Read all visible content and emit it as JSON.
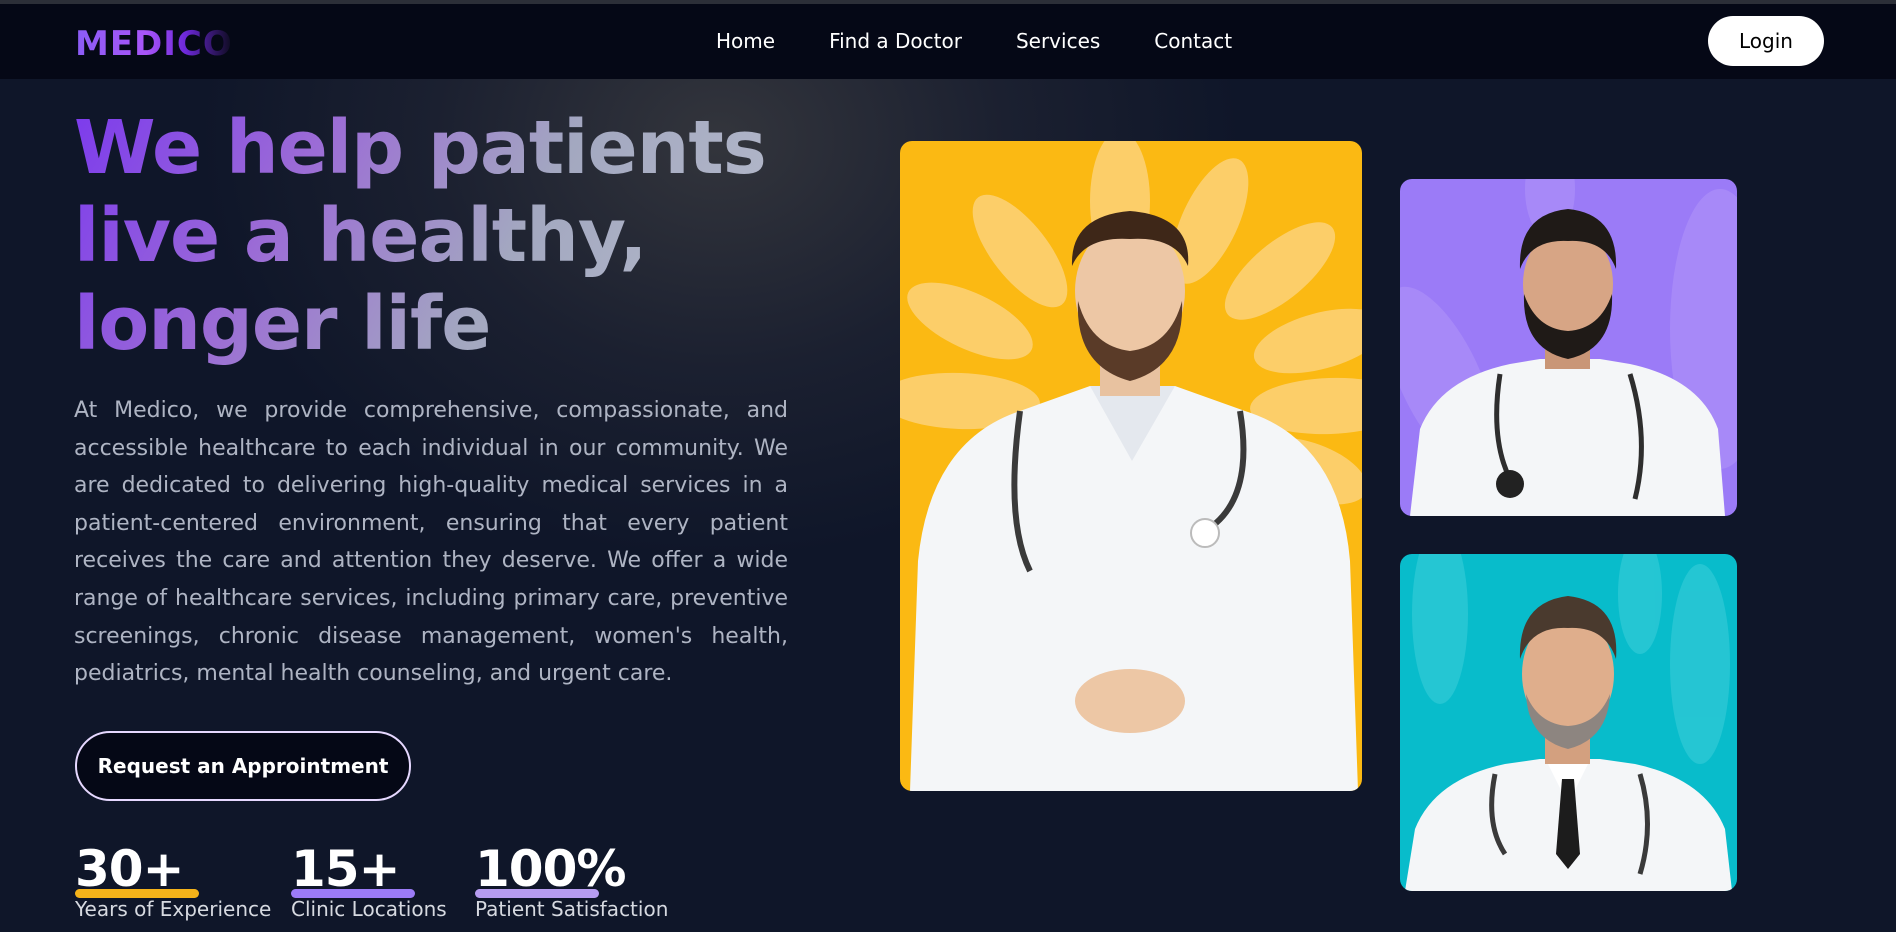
{
  "nav": {
    "logo": "MEDICO",
    "links": [
      "Home",
      "Find a Doctor",
      "Services",
      "Contact"
    ],
    "login_label": "Login"
  },
  "hero": {
    "headline_line1": "We help patients",
    "headline_line2": "live a healthy,",
    "headline_line3": "longer life",
    "description": "At Medico, we provide comprehensive, compassionate, and accessible healthcare to each individual in our community. We are dedicated to delivering high-quality medical services in a patient-centered environment, ensuring that every patient receives the care and attention they deserve. We offer a wide range of healthcare services, including primary care, preventive screenings, chronic disease management, women's health, pediatrics, mental health counseling, and urgent care.",
    "cta_label": "Request an Approintment"
  },
  "stats": [
    {
      "value": "30+",
      "label": "Years of Experience",
      "accent": "#f5b31a"
    },
    {
      "value": "15+",
      "label": "Clinic Locations",
      "accent": "#9b7bf7"
    },
    {
      "value": "100%",
      "label": "Patient Satisfaction",
      "accent": "#b69cf0"
    }
  ],
  "cards": [
    {
      "name": "doctor-card-main",
      "background": "#fbb913"
    },
    {
      "name": "doctor-card-top",
      "background": "#9b7bf7"
    },
    {
      "name": "doctor-card-bottom",
      "background": "#08bccb"
    }
  ]
}
